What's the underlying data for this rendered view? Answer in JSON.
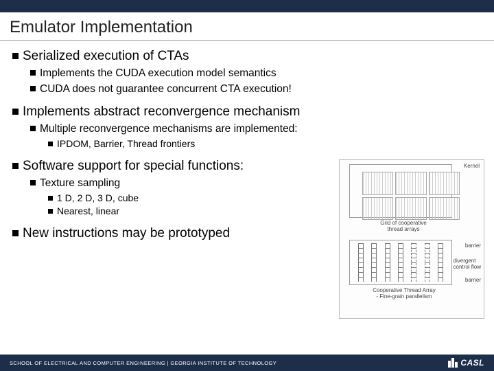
{
  "title": "Emulator Implementation",
  "bullets": {
    "s1": "Serialized execution of CTAs",
    "s1a": "Implements the CUDA execution model semantics",
    "s1b": "CUDA does not guarantee concurrent CTA execution!",
    "s2": "Implements abstract reconvergence mechanism",
    "s2a": "Multiple reconvergence mechanisms are implemented:",
    "s2a1": "IPDOM, Barrier, Thread frontiers",
    "s3": "Software support for special functions:",
    "s3a": "Texture sampling",
    "s3a1": "1 D, 2 D, 3 D, cube",
    "s3a2": "Nearest, linear",
    "s4": "New instructions may be prototyped"
  },
  "diagram": {
    "kernel": "Kernel",
    "barrier": "barrier",
    "divergent": "divergent\ncontrol flow",
    "grid_caption": "Grid of cooperative\nthread arrays",
    "cta_caption": "Cooperative Thread Array\n- Fine-grain parallelism"
  },
  "footer": {
    "text": "SCHOOL OF ELECTRICAL AND COMPUTER ENGINEERING | GEORGIA INSTITUTE OF TECHNOLOGY",
    "logo": "CASL"
  }
}
